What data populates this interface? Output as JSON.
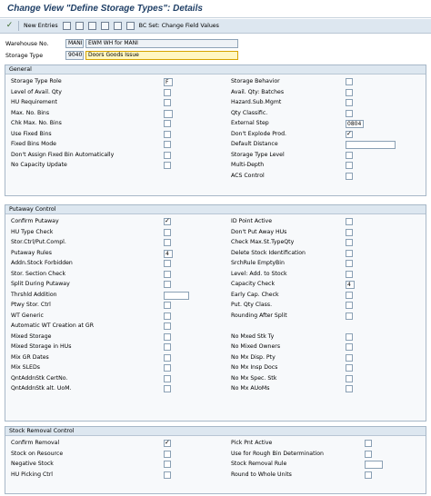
{
  "title": "Change View \"Define Storage Types\": Details",
  "toolbar": {
    "new_entries": "New Entries",
    "bc_set": "BC Set: Change Field Values"
  },
  "header": {
    "warehouse_label": "Warehouse No.",
    "warehouse_value": "MANI",
    "warehouse_desc": "EWM WH for MANI",
    "storage_type_label": "Storage Type",
    "storage_type_value": "9040",
    "storage_type_desc": "Doors Goods Issue"
  },
  "general": {
    "title": "General",
    "left": [
      {
        "label": "Storage Type Role",
        "type": "value",
        "value": "F"
      },
      {
        "label": "Level of Avail. Qty",
        "type": "checkbox",
        "checked": false
      },
      {
        "label": "HU Requirement",
        "type": "checkbox",
        "checked": false
      },
      {
        "label": "Max. No. Bins",
        "type": "value",
        "value": ""
      },
      {
        "label": "Chk Max. No. Bins",
        "type": "checkbox",
        "checked": false
      },
      {
        "label": "Use Fixed Bins",
        "type": "checkbox",
        "checked": false
      },
      {
        "label": "Fixed Bins Mode",
        "type": "checkbox",
        "checked": false
      },
      {
        "label": "Don't Assign Fixed Bin Automatically",
        "type": "checkbox",
        "checked": false
      },
      {
        "label": "No Capacity Update",
        "type": "checkbox",
        "checked": false
      }
    ],
    "right": [
      {
        "label": "Storage Behavior",
        "type": "checkbox",
        "checked": false
      },
      {
        "label": "Avail. Qty: Batches",
        "type": "checkbox",
        "checked": false
      },
      {
        "label": "Hazard.Sub.Mgmt",
        "type": "checkbox",
        "checked": false
      },
      {
        "label": "Qty Classific.",
        "type": "checkbox",
        "checked": false
      },
      {
        "label": "External Step",
        "type": "value",
        "value": "0804"
      },
      {
        "label": "Don't Explode Prod.",
        "type": "checkbox",
        "checked": true
      },
      {
        "label": "Default Distance",
        "type": "wide",
        "value": ""
      },
      {
        "label": "Storage Type Level",
        "type": "checkbox",
        "checked": false
      },
      {
        "label": "Multi-Depth",
        "type": "checkbox",
        "checked": false
      },
      {
        "label": "ACS Control",
        "type": "checkbox",
        "checked": false
      }
    ]
  },
  "putaway": {
    "title": "Putaway Control",
    "left": [
      {
        "label": "Confirm Putaway",
        "type": "checkbox",
        "checked": true
      },
      {
        "label": "HU Type Check",
        "type": "checkbox",
        "checked": false
      },
      {
        "label": "Stor.Ctrl/Put.Compl.",
        "type": "checkbox",
        "checked": false
      },
      {
        "label": "Putaway Rules",
        "type": "value",
        "value": "4"
      },
      {
        "label": "Addn.Stock Forbidden",
        "type": "checkbox",
        "checked": false
      },
      {
        "label": "Stor. Section Check",
        "type": "checkbox",
        "checked": false
      },
      {
        "label": "Split During Putaway",
        "type": "checkbox",
        "checked": false
      },
      {
        "label": "Thrshld Addition",
        "type": "wide",
        "value": ""
      },
      {
        "label": "Ptwy Stor. Ctrl",
        "type": "checkbox",
        "checked": false
      },
      {
        "label": "WT Generic",
        "type": "checkbox",
        "checked": false
      },
      {
        "label": "Automatic WT Creation at GR",
        "type": "checkbox",
        "checked": false
      },
      {
        "label": "Mixed Storage",
        "type": "checkbox",
        "checked": false
      },
      {
        "label": "Mixed Storage in HUs",
        "type": "checkbox",
        "checked": false
      },
      {
        "label": "Mix GR Dates",
        "type": "checkbox",
        "checked": false
      },
      {
        "label": "Mix SLEDs",
        "type": "checkbox",
        "checked": false
      },
      {
        "label": "QntAddnStk CertNo.",
        "type": "checkbox",
        "checked": false
      },
      {
        "label": "QntAddnStk alt. UoM.",
        "type": "checkbox",
        "checked": false
      }
    ],
    "right": [
      {
        "label": "ID Point Active",
        "type": "checkbox",
        "checked": false
      },
      {
        "label": "Don't Put Away HUs",
        "type": "checkbox",
        "checked": false
      },
      {
        "label": "Check Max.St.TypeQty",
        "type": "checkbox",
        "checked": false
      },
      {
        "label": "Delete Stock Identification",
        "type": "checkbox",
        "checked": false
      },
      {
        "label": "SrchRule EmptyBin",
        "type": "checkbox",
        "checked": false
      },
      {
        "label": "Level: Add. to Stock",
        "type": "checkbox",
        "checked": false
      },
      {
        "label": "Capacity Check",
        "type": "value",
        "value": "4"
      },
      {
        "label": "Early Cap. Check",
        "type": "checkbox",
        "checked": false
      },
      {
        "label": "Put. Qty Class.",
        "type": "checkbox",
        "checked": false
      },
      {
        "label": "Rounding After Split",
        "type": "checkbox",
        "checked": false
      },
      {
        "label": "",
        "type": "none"
      },
      {
        "label": "No Mxed Stk Ty",
        "type": "checkbox",
        "checked": false
      },
      {
        "label": "No Mixed Owners",
        "type": "checkbox",
        "checked": false
      },
      {
        "label": "No Mx Disp. Pty",
        "type": "checkbox",
        "checked": false
      },
      {
        "label": "No Mx Insp Docs",
        "type": "checkbox",
        "checked": false
      },
      {
        "label": "No Mx Spec. Stk",
        "type": "checkbox",
        "checked": false
      },
      {
        "label": "No Mx AUoMs",
        "type": "checkbox",
        "checked": false
      }
    ]
  },
  "removal": {
    "title": "Stock Removal Control",
    "left": [
      {
        "label": "Confirm Removal",
        "type": "checkbox",
        "checked": true
      },
      {
        "label": "Stock on Resource",
        "type": "checkbox",
        "checked": false
      },
      {
        "label": "Negative Stock",
        "type": "checkbox",
        "checked": false
      },
      {
        "label": "HU Picking Ctrl",
        "type": "checkbox",
        "checked": false
      }
    ],
    "right": [
      {
        "label": "Pick Pnt Active",
        "type": "checkbox",
        "checked": false
      },
      {
        "label": "Use for Rough Bin Determination",
        "type": "checkbox",
        "checked": false
      },
      {
        "label": "Stock Removal Rule",
        "type": "value",
        "value": ""
      },
      {
        "label": "Round to Whole Units",
        "type": "checkbox",
        "checked": false
      }
    ]
  }
}
